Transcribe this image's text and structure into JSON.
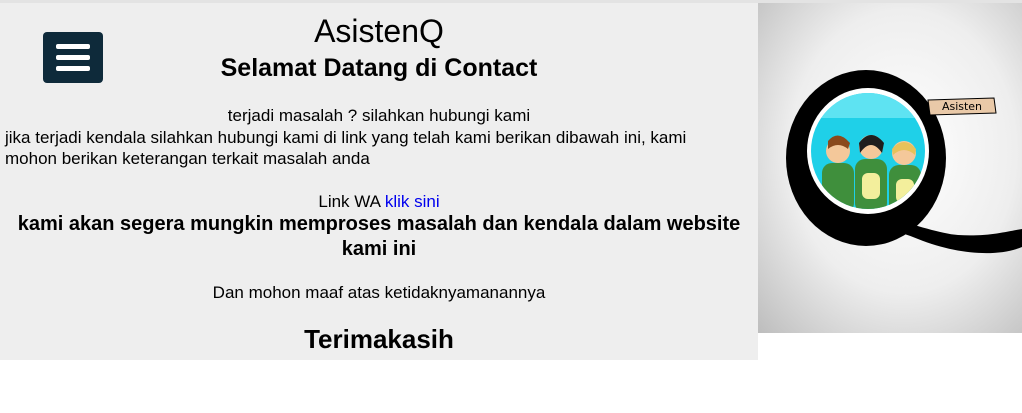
{
  "site": {
    "title": "AsistenQ",
    "subtitle": "Selamat Datang di Contact"
  },
  "content": {
    "problem_line": "terjadi masalah ? silahkan hubungi kami",
    "description": "jika terjadi kendala silahkan hubungi kami di link yang telah kami berikan dibawah ini, kami mohon berikan keterangan terkait masalah anda",
    "wa_label": "Link WA",
    "wa_link_text": "klik sini",
    "process_text": "kami akan segera mungkin memproses masalah dan kendala dalam website kami ini",
    "apology": "Dan mohon maaf atas ketidaknyamanannya",
    "thanks": "Terimakasih"
  },
  "logo": {
    "badge_text": "Asisten"
  },
  "icons": {
    "menu": "hamburger-menu-icon"
  },
  "colors": {
    "menu_bg": "#0e2a3a",
    "page_bg": "#eeeeee",
    "link": "#0000ee"
  }
}
